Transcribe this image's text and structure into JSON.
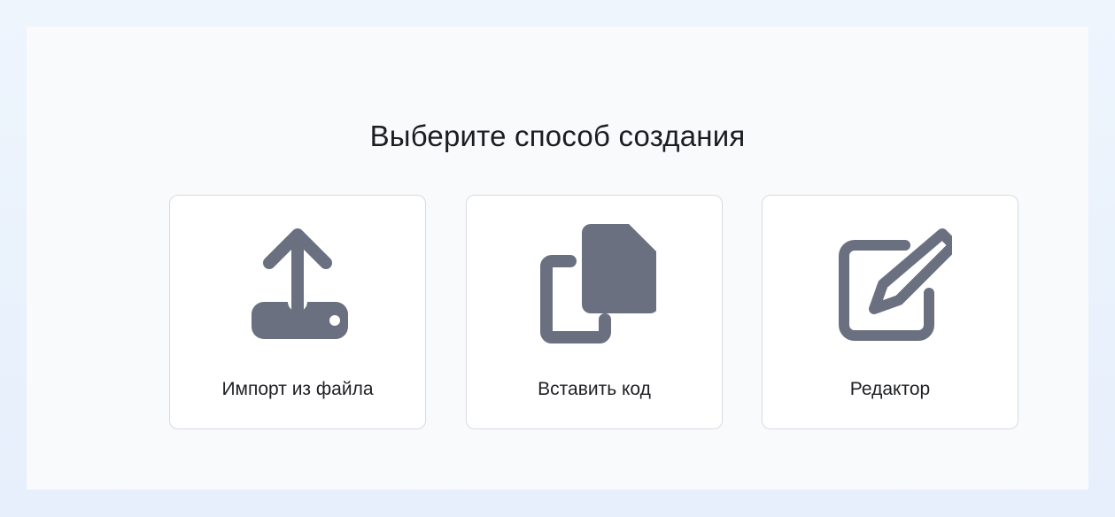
{
  "dialog": {
    "title": "Выберите способ создания",
    "options": [
      {
        "label": "Импорт из файла",
        "icon": "upload-icon"
      },
      {
        "label": "Вставить код",
        "icon": "copy-icon"
      },
      {
        "label": "Редактор",
        "icon": "edit-icon"
      }
    ]
  },
  "colors": {
    "icon": "#6b7080",
    "card_border": "#d9dbe0",
    "panel_bg": "#f9fafc"
  }
}
